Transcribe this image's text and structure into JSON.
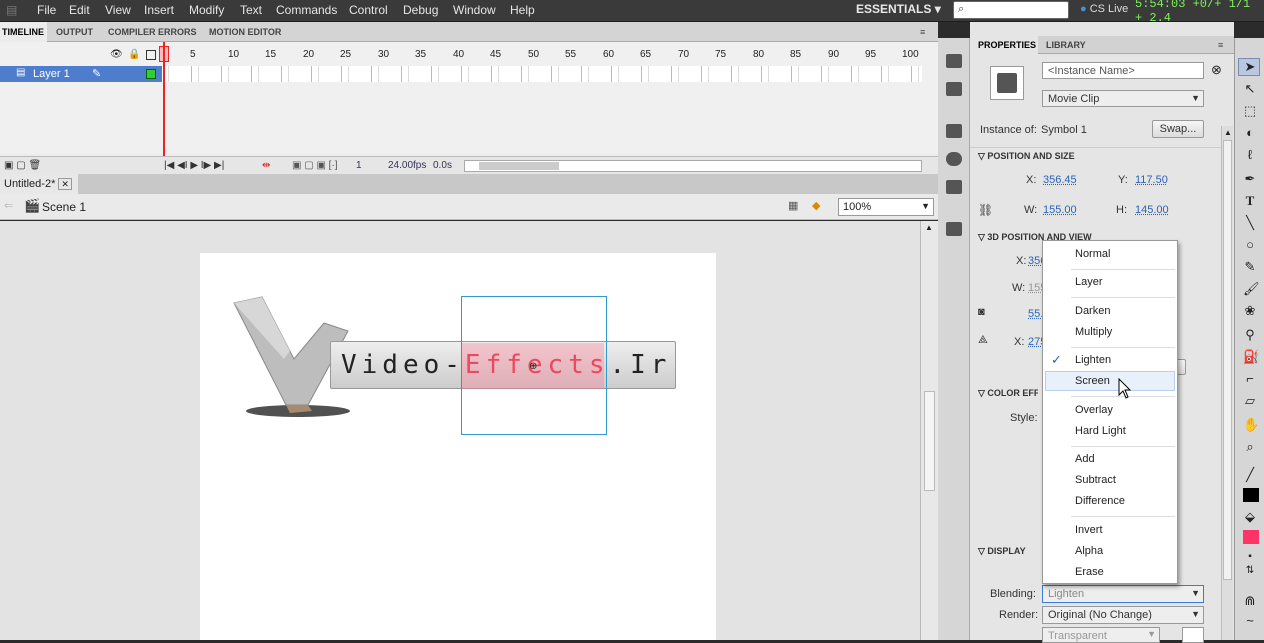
{
  "menu": [
    "File",
    "Edit",
    "View",
    "Insert",
    "Modify",
    "Text",
    "Commands",
    "Control",
    "Debug",
    "Window",
    "Help"
  ],
  "workspace": "ESSENTIALS",
  "cs_live": "CS Live",
  "clock": "5:54:03 +0/+ 1/1 + 2.4",
  "timeline": {
    "tabs": [
      "TIMELINE",
      "OUTPUT",
      "COMPILER ERRORS",
      "MOTION EDITOR"
    ],
    "ruler": [
      "1",
      "5",
      "10",
      "15",
      "20",
      "25",
      "30",
      "35",
      "40",
      "45",
      "50",
      "55",
      "60",
      "65",
      "70",
      "75",
      "80",
      "85",
      "90",
      "95",
      "100"
    ],
    "layer": "Layer 1",
    "frame": "1",
    "fps": "24.00",
    "fps_unit": "fps",
    "time": "0.0",
    "time_unit": "s"
  },
  "document": {
    "tab": "Untitled-2*",
    "scene": "Scene 1",
    "zoom": "100%"
  },
  "stage": {
    "logo_left": "Video-",
    "logo_red": "Effects",
    "logo_right": ".Ir"
  },
  "properties": {
    "tabs": [
      "PROPERTIES",
      "LIBRARY"
    ],
    "instance_placeholder": "<Instance Name>",
    "type": "Movie Clip",
    "instance_of_label": "Instance of:",
    "instance_of": "Symbol 1",
    "swap": "Swap...",
    "sec_pos": "POSITION AND SIZE",
    "x_label": "X:",
    "x": "356.45",
    "y_label": "Y:",
    "y": "117.50",
    "w_label": "W:",
    "w": "155.00",
    "h_label": "H:",
    "h": "145.00",
    "sec_3d": "3D POSITION AND VIEW",
    "x3d": "356",
    "w3d": "155",
    "v3": "55.",
    "v4": "275",
    "sec_color": "COLOR EFFECT",
    "style_label": "Style:",
    "sec_display": "DISPLAY",
    "blending_label": "Blending:",
    "blending": "Lighten",
    "render_label": "Render:",
    "render": "Original (No Change)",
    "transparent": "Transparent"
  },
  "blend_options": {
    "normal": "Normal",
    "layer": "Layer",
    "darken": "Darken",
    "multiply": "Multiply",
    "lighten": "Lighten",
    "screen": "Screen",
    "overlay": "Overlay",
    "hardlight": "Hard Light",
    "add": "Add",
    "subtract": "Subtract",
    "difference": "Difference",
    "invert": "Invert",
    "alpha": "Alpha",
    "erase": "Erase"
  }
}
